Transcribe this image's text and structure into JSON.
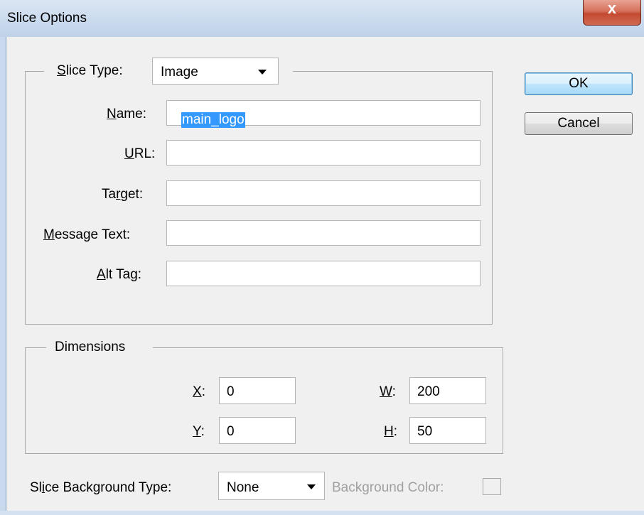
{
  "window": {
    "title": "Slice Options",
    "close_glyph": "x"
  },
  "slice_group": {
    "slice_type_label": "Slice Type:",
    "slice_type_value": "Image",
    "fields": [
      {
        "label": "Name:",
        "value": "main_logo",
        "selected": true
      },
      {
        "label": "URL:",
        "value": ""
      },
      {
        "label": "Target:",
        "value": ""
      },
      {
        "label": "Message Text:",
        "value": ""
      },
      {
        "label": "Alt Tag:",
        "value": ""
      }
    ]
  },
  "dimensions": {
    "legend": "Dimensions",
    "x_label": "X:",
    "x_value": "0",
    "y_label": "Y:",
    "y_value": "0",
    "w_label": "W:",
    "w_value": "200",
    "h_label": "H:",
    "h_value": "50"
  },
  "background": {
    "type_label": "Slice Background Type:",
    "type_value": "None",
    "color_label": "Background Color:"
  },
  "buttons": {
    "ok": "OK",
    "cancel": "Cancel"
  }
}
